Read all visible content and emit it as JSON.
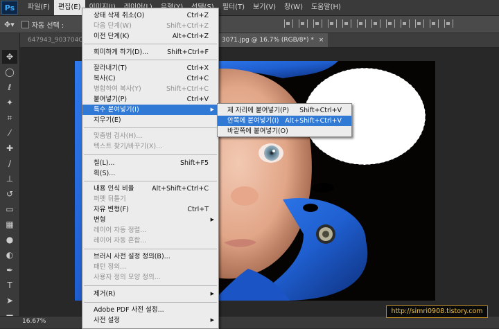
{
  "menubar": {
    "items": [
      "파일(F)",
      "편집(E)",
      "이미지(I)",
      "레이어(L)",
      "유형(Y)",
      "선택(S)",
      "필터(T)",
      "보기(V)",
      "창(W)",
      "도움말(H)"
    ]
  },
  "app_logo": "Ps",
  "options": {
    "auto_select_label": "자동 선택 :"
  },
  "tabs": {
    "left_tab": "647943_903704C",
    "active_tab": "3071.jpg @ 16.7% (RGB/8*) *",
    "close": "×"
  },
  "edit_menu": {
    "items": [
      {
        "label": "상태 삭제 취소(O)",
        "shortcut": "Ctrl+Z",
        "disabled": false
      },
      {
        "label": "다음 단계(W)",
        "shortcut": "Shift+Ctrl+Z",
        "disabled": true
      },
      {
        "label": "이전 단계(K)",
        "shortcut": "Alt+Ctrl+Z",
        "disabled": false
      },
      {
        "label": "희미하게 하기(D)...",
        "shortcut": "Shift+Ctrl+F",
        "disabled": false
      },
      {
        "label": "잘라내기(T)",
        "shortcut": "Ctrl+X",
        "disabled": false
      },
      {
        "label": "복사(C)",
        "shortcut": "Ctrl+C",
        "disabled": false
      },
      {
        "label": "병합하여 복사(Y)",
        "shortcut": "Shift+Ctrl+C",
        "disabled": true
      },
      {
        "label": "붙여넣기(P)",
        "shortcut": "Ctrl+V",
        "disabled": false
      },
      {
        "label": "특수 붙여넣기(I)",
        "shortcut": "",
        "disabled": false
      },
      {
        "label": "지우기(E)",
        "shortcut": "",
        "disabled": false
      },
      {
        "label": "맞춤법 검사(H)...",
        "shortcut": "",
        "disabled": true
      },
      {
        "label": "텍스트 찾기/바꾸기(X)...",
        "shortcut": "",
        "disabled": true
      },
      {
        "label": "칠(L)...",
        "shortcut": "Shift+F5",
        "disabled": false
      },
      {
        "label": "획(S)...",
        "shortcut": "",
        "disabled": false
      },
      {
        "label": "내용 인식 비율",
        "shortcut": "Alt+Shift+Ctrl+C",
        "disabled": false
      },
      {
        "label": "퍼펫 뒤틀기",
        "shortcut": "",
        "disabled": true
      },
      {
        "label": "자유 변형(F)",
        "shortcut": "Ctrl+T",
        "disabled": false
      },
      {
        "label": "변형",
        "shortcut": "",
        "disabled": false
      },
      {
        "label": "레이어 자동 정렬...",
        "shortcut": "",
        "disabled": true
      },
      {
        "label": "레이어 자동 혼합...",
        "shortcut": "",
        "disabled": true
      },
      {
        "label": "브러시 사전 설정 정의(B)...",
        "shortcut": "",
        "disabled": false
      },
      {
        "label": "패턴 정의...",
        "shortcut": "",
        "disabled": true
      },
      {
        "label": "사용자 정의 모양 정의...",
        "shortcut": "",
        "disabled": true
      },
      {
        "label": "제거(R)",
        "shortcut": "",
        "disabled": false
      },
      {
        "label": "Adobe PDF 사전 설정...",
        "shortcut": "",
        "disabled": false
      },
      {
        "label": "사전 설정",
        "shortcut": "",
        "disabled": false
      }
    ]
  },
  "paste_special_submenu": {
    "items": [
      {
        "label": "제 자리에 붙여넣기(P)",
        "shortcut": "Shift+Ctrl+V"
      },
      {
        "label": "안쪽에 붙여넣기(I)",
        "shortcut": "Alt+Shift+Ctrl+V"
      },
      {
        "label": "바깥쪽에 붙여넣기(O)",
        "shortcut": ""
      }
    ]
  },
  "status": {
    "zoom": "16.67%"
  },
  "watermark": "http://simri0908.tistory.com",
  "colors": {
    "menu_highlight": "#3079d5",
    "hood_blue": "#1f5fd0",
    "watermark_text": "#f2c64a"
  },
  "icons": [
    "move-tool-icon",
    "marquee-tool-icon",
    "lasso-tool-icon",
    "quick-select-icon",
    "crop-tool-icon",
    "eyedropper-icon",
    "healing-brush-icon",
    "brush-tool-icon",
    "clone-stamp-icon",
    "history-brush-icon",
    "eraser-icon",
    "gradient-icon",
    "blur-icon",
    "dodge-icon",
    "pen-tool-icon",
    "type-tool-icon",
    "path-select-icon",
    "shape-tool-icon"
  ]
}
